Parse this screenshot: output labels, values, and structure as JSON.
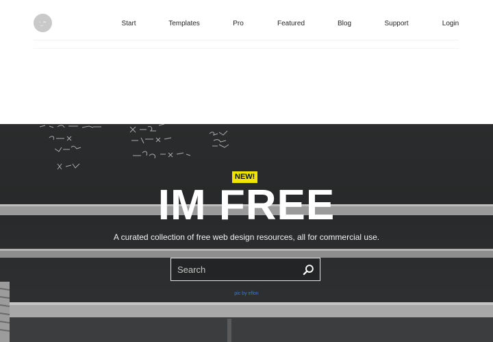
{
  "logo": {
    "text": "ⁱ_ᴹ"
  },
  "nav": [
    {
      "id": "start",
      "label": "Start"
    },
    {
      "id": "templates",
      "label": "Templates"
    },
    {
      "id": "pro",
      "label": "Pro"
    },
    {
      "id": "featured",
      "label": "Featured"
    },
    {
      "id": "blog",
      "label": "Blog"
    },
    {
      "id": "support",
      "label": "Support"
    },
    {
      "id": "login",
      "label": "Login"
    }
  ],
  "hero": {
    "badge": "NEW!",
    "title": "IM FREE",
    "subtitle": "A curated collection of free web design resources, all for commercial use.",
    "search": {
      "placeholder": "Search",
      "value": "",
      "button_icon": "search-icon"
    },
    "credit": "pic by eflon",
    "colors": {
      "badge": "#f2e400",
      "credit_link": "#3a7bd5"
    }
  }
}
